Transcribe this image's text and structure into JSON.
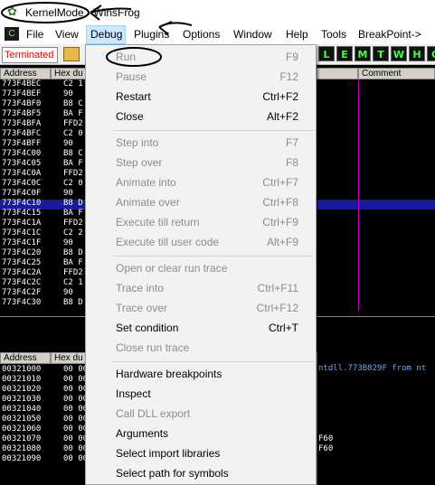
{
  "window": {
    "title": "KernelMode - WinsFrog"
  },
  "menubar": {
    "items": [
      "File",
      "View",
      "Debug",
      "Plugins",
      "Options",
      "Window",
      "Help",
      "Tools",
      "BreakPoint->"
    ]
  },
  "toolbar": {
    "status": "Terminated",
    "buttons": [
      "L",
      "E",
      "M",
      "T",
      "W",
      "H",
      "C"
    ]
  },
  "disasm": {
    "headers": {
      "address": "Address",
      "hex": "Hex du",
      "comment": "Comment"
    },
    "rows": [
      {
        "addr": "773F4BEC",
        "hex": "C2 1"
      },
      {
        "addr": "773F4BEF",
        "hex": "90"
      },
      {
        "addr": "773F4BF0",
        "hex": "B8 C"
      },
      {
        "addr": "773F4BF5",
        "hex": "BA F"
      },
      {
        "addr": "773F4BFA",
        "hex": "FFD2"
      },
      {
        "addr": "773F4BFC",
        "hex": "C2 0"
      },
      {
        "addr": "773F4BFF",
        "hex": "90"
      },
      {
        "addr": "773F4C00",
        "hex": "B8 C"
      },
      {
        "addr": "773F4C05",
        "hex": "BA F"
      },
      {
        "addr": "773F4C0A",
        "hex": "FFD2"
      },
      {
        "addr": "773F4C0C",
        "hex": "C2 0"
      },
      {
        "addr": "773F4C0F",
        "hex": "90"
      },
      {
        "addr": "773F4C10",
        "hex": "B8 D"
      },
      {
        "addr": "773F4C15",
        "hex": "BA F"
      },
      {
        "addr": "773F4C1A",
        "hex": "FFD2"
      },
      {
        "addr": "773F4C1C",
        "hex": "C2 2"
      },
      {
        "addr": "773F4C1F",
        "hex": "90"
      },
      {
        "addr": "773F4C20",
        "hex": "B8 D"
      },
      {
        "addr": "773F4C25",
        "hex": "BA F"
      },
      {
        "addr": "773F4C2A",
        "hex": "FFD2"
      },
      {
        "addr": "773F4C2C",
        "hex": "C2 1"
      },
      {
        "addr": "773F4C2F",
        "hex": "90"
      },
      {
        "addr": "773F4C30",
        "hex": "B8 D"
      }
    ]
  },
  "dump": {
    "headers": {
      "address": "Address",
      "hex": "Hex du"
    },
    "rows": [
      {
        "addr": "00321000",
        "hex": "00 00"
      },
      {
        "addr": "00321010",
        "hex": "00 00"
      },
      {
        "addr": "00321020",
        "hex": "00 00"
      },
      {
        "addr": "00321030",
        "hex": "00 00"
      },
      {
        "addr": "00321040",
        "hex": "00 00"
      },
      {
        "addr": "00321050",
        "hex": "00 00"
      },
      {
        "addr": "00321060",
        "hex": "00 00"
      },
      {
        "addr": "00321070",
        "hex": "00 00"
      },
      {
        "addr": "00321080",
        "hex": "00 00"
      },
      {
        "addr": "00321090",
        "hex": "00 00"
      }
    ],
    "info": "ntdll.773B829F from nt",
    "footer": [
      "F60",
      "F60"
    ]
  },
  "debug_menu": {
    "items": [
      {
        "label": "Run",
        "shortcut": "F9",
        "enabled": false
      },
      {
        "label": "Pause",
        "shortcut": "F12",
        "enabled": false
      },
      {
        "label": "Restart",
        "shortcut": "Ctrl+F2",
        "enabled": true
      },
      {
        "label": "Close",
        "shortcut": "Alt+F2",
        "enabled": true
      },
      {
        "label": "Step into",
        "shortcut": "F7",
        "enabled": false
      },
      {
        "label": "Step over",
        "shortcut": "F8",
        "enabled": false
      },
      {
        "label": "Animate into",
        "shortcut": "Ctrl+F7",
        "enabled": false
      },
      {
        "label": "Animate over",
        "shortcut": "Ctrl+F8",
        "enabled": false
      },
      {
        "label": "Execute till return",
        "shortcut": "Ctrl+F9",
        "enabled": false
      },
      {
        "label": "Execute till user code",
        "shortcut": "Alt+F9",
        "enabled": false
      },
      {
        "label": "Open or clear run trace",
        "shortcut": "",
        "enabled": false
      },
      {
        "label": "Trace into",
        "shortcut": "Ctrl+F11",
        "enabled": false
      },
      {
        "label": "Trace over",
        "shortcut": "Ctrl+F12",
        "enabled": false
      },
      {
        "label": "Set condition",
        "shortcut": "Ctrl+T",
        "enabled": true
      },
      {
        "label": "Close run trace",
        "shortcut": "",
        "enabled": false
      },
      {
        "label": "Hardware breakpoints",
        "shortcut": "",
        "enabled": true
      },
      {
        "label": "Inspect",
        "shortcut": "",
        "enabled": true
      },
      {
        "label": "Call DLL export",
        "shortcut": "",
        "enabled": false
      },
      {
        "label": "Arguments",
        "shortcut": "",
        "enabled": true
      },
      {
        "label": "Select import libraries",
        "shortcut": "",
        "enabled": true
      },
      {
        "label": "Select path for symbols",
        "shortcut": "",
        "enabled": true
      }
    ]
  },
  "colors": {
    "menu_highlight": "#cce8ff",
    "status_text": "#e00000",
    "selected_row": "#1a1aa0",
    "divider": "#c000c0",
    "toolbar_letters": "#44ff44"
  }
}
